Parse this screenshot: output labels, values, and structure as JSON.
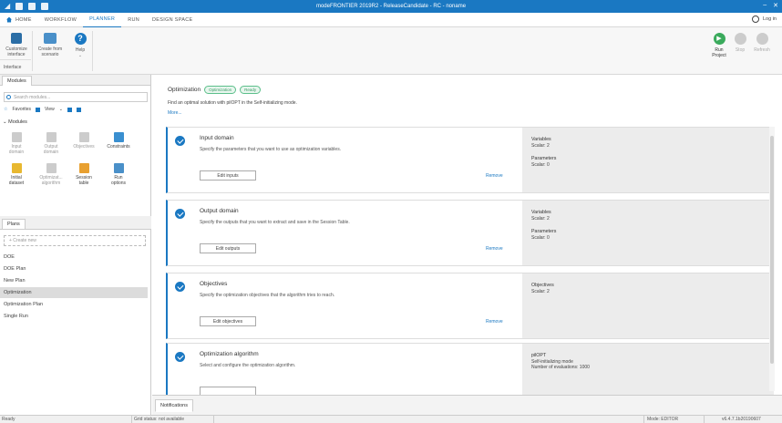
{
  "window": {
    "title": "modeFRONTIER 2019R2 - ReleaseCandidate - RC - noname",
    "controls": [
      "–",
      "✕"
    ]
  },
  "menu": {
    "items": [
      "HOME",
      "WORKFLOW",
      "PLANNER",
      "RUN",
      "DESIGN SPACE"
    ],
    "active": "PLANNER",
    "login": "Log in"
  },
  "ribbon": {
    "customize": "Customize\nInterface",
    "customize_l1": "Customize",
    "customize_l2": "interface",
    "create_l1": "Create from",
    "create_l2": "scenario",
    "help": "Help",
    "group": "Interface",
    "run_l1": "Run",
    "run_l2": "Project",
    "stop": "Stop",
    "refresh": "Refresh"
  },
  "modules": {
    "tab": "Modules",
    "search_placeholder": "Search modules...",
    "favorites": "Favorites",
    "view": "View",
    "header": "Modules",
    "items": [
      {
        "l1": "Input",
        "l2": "domain"
      },
      {
        "l1": "Output",
        "l2": "domain"
      },
      {
        "l1": "Objectives",
        "l2": ""
      },
      {
        "l1": "Constraints",
        "l2": ""
      },
      {
        "l1": "Initial",
        "l2": "dataset"
      },
      {
        "l1": "Optimizat...",
        "l2": "algorithm"
      },
      {
        "l1": "Session",
        "l2": "table"
      },
      {
        "l1": "Run",
        "l2": "options"
      }
    ]
  },
  "plans": {
    "tab": "Plans",
    "create": "+ Create new",
    "items": [
      "DOE",
      "DOE Plan",
      "New Plan",
      "Optimization",
      "Optimization Plan",
      "Single Run"
    ],
    "selected": "Optimization"
  },
  "main": {
    "title": "Optimization",
    "badge1": "Optimization",
    "badge2": "Ready",
    "desc": "Find an optimal solution with pilOPT in the Self-initializing mode.",
    "more": "More...",
    "cards": [
      {
        "title": "Input domain",
        "desc": "Specify the parameters that you want to use as optimization variables.",
        "button": "Edit inputs",
        "remove": "Remove",
        "side": [
          {
            "label": "Variables",
            "value": "Scalar: 2"
          },
          {
            "label": "Parameters",
            "value": "Scalar: 0"
          }
        ]
      },
      {
        "title": "Output domain",
        "desc": "Specify the outputs that you want to extract and save in the Session Table.",
        "button": "Edit outputs",
        "remove": "Remove",
        "side": [
          {
            "label": "Variables",
            "value": "Scalar: 2"
          },
          {
            "label": "Parameters",
            "value": "Scalar: 0"
          }
        ]
      },
      {
        "title": "Objectives",
        "desc": "Specify the optimization objectives that the algorithm tries to reach.",
        "button": "Edit objectives",
        "remove": "Remove",
        "side": [
          {
            "label": "Objectives",
            "value": "Scalar: 2"
          }
        ]
      },
      {
        "title": "Optimization algorithm",
        "desc": "Select and configure the optimization algorithm.",
        "button": "",
        "remove": "",
        "side_lines": [
          "pilOPT",
          "Self-initializing mode",
          "Number of evaluations: 1000"
        ]
      }
    ]
  },
  "notifications": {
    "tab": "Notifications"
  },
  "status": {
    "left": "Ready",
    "grid": "Grid status: not available",
    "mode": "Mode: EDITOR",
    "version": "v6.4.7.1b20190607"
  }
}
